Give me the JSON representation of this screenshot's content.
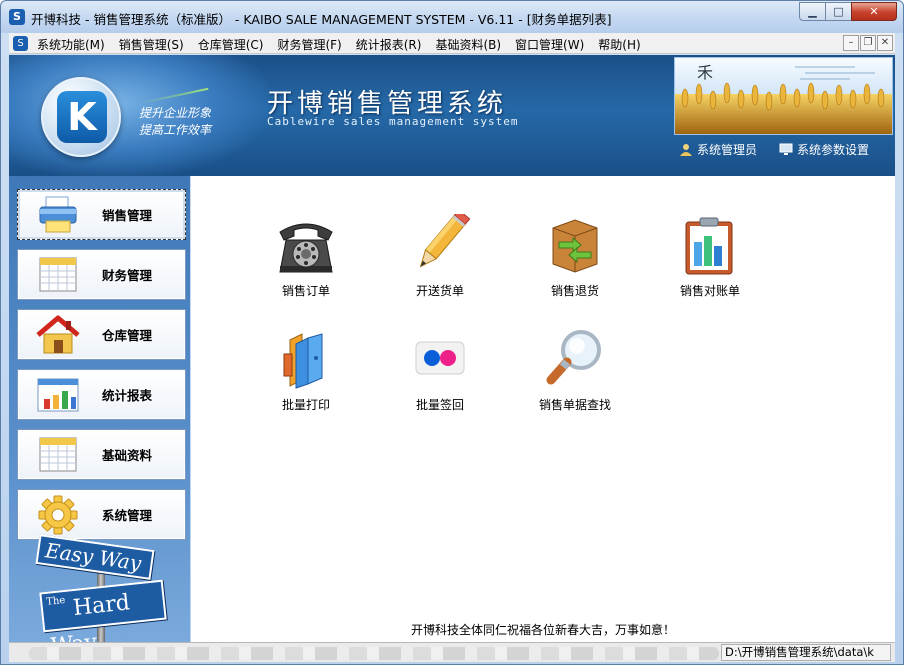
{
  "window": {
    "title": "开博科技 - 销售管理系统（标准版） - KAIBO SALE MANAGEMENT SYSTEM - V6.11 - [财务单据列表]",
    "controls": {
      "minimize": "▁",
      "maximize": "□",
      "close": "✕"
    }
  },
  "menubar": {
    "items": [
      {
        "label": "系统功能(M)"
      },
      {
        "label": "销售管理(S)"
      },
      {
        "label": "仓库管理(C)"
      },
      {
        "label": "财务管理(F)"
      },
      {
        "label": "统计报表(R)"
      },
      {
        "label": "基础资料(B)"
      },
      {
        "label": "窗口管理(W)"
      },
      {
        "label": "帮助(H)"
      }
    ],
    "mdi_controls": {
      "minimize": "–",
      "restore": "❐",
      "close": "✕"
    }
  },
  "banner": {
    "logo_letter": "K",
    "slogan_line1": "提升企业形象",
    "slogan_line2": "提高工作效率",
    "system_title": "开博销售管理系统",
    "system_subtitle": "Cablewire sales management system",
    "user_link": "系统管理员",
    "settings_link": "系统参数设置"
  },
  "sidebar": {
    "items": [
      {
        "label": "销售管理",
        "icon": "printer-icon",
        "active": true
      },
      {
        "label": "财务管理",
        "icon": "spreadsheet-icon",
        "active": false
      },
      {
        "label": "仓库管理",
        "icon": "house-icon",
        "active": false
      },
      {
        "label": "统计报表",
        "icon": "bar-chart-icon",
        "active": false
      },
      {
        "label": "基础资料",
        "icon": "table-icon",
        "active": false
      },
      {
        "label": "系统管理",
        "icon": "gear-icon",
        "active": false
      }
    ],
    "sign_top": "Easy Way",
    "sign_bottom_small": "The",
    "sign_bottom": "Hard Way"
  },
  "main": {
    "tiles": [
      {
        "label": "销售订单",
        "icon": "telephone-icon"
      },
      {
        "label": "开送货单",
        "icon": "pencil-icon"
      },
      {
        "label": "销售退货",
        "icon": "return-box-icon"
      },
      {
        "label": "销售对账单",
        "icon": "clipboard-chart-icon"
      },
      {
        "label": "批量打印",
        "icon": "books-icon"
      },
      {
        "label": "批量签回",
        "icon": "flickr-dots-icon"
      },
      {
        "label": "销售单据查找",
        "icon": "magnifier-icon"
      }
    ],
    "greeting": "开博科技全体同仁祝福各位新春大吉，万事如意！"
  },
  "statusbar": {
    "path": "D:\\开博销售管理系统\\data\\k"
  },
  "colors": {
    "banner_blue": "#2569a8",
    "sidebar_blue": "#5a8fcb",
    "title_bar": "#c6d9f1",
    "close_red": "#c7402a"
  }
}
